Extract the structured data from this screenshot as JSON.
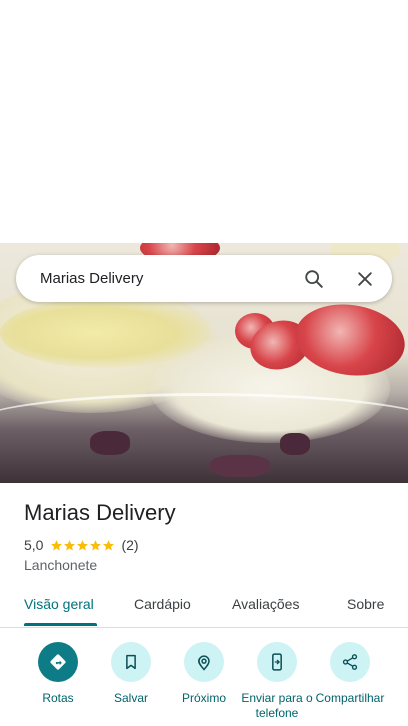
{
  "search": {
    "query": "Marias Delivery",
    "search_icon": "search-icon",
    "close_icon": "close-icon"
  },
  "place": {
    "name": "Marias Delivery",
    "rating_value": "5,0",
    "rating_stars": 5,
    "review_count": "(2)",
    "category": "Lanchonete"
  },
  "tabs": [
    {
      "label": "Visão geral",
      "active": true
    },
    {
      "label": "Cardápio",
      "active": false
    },
    {
      "label": "Avaliações",
      "active": false
    },
    {
      "label": "Sobre",
      "active": false
    }
  ],
  "actions": [
    {
      "label": "Rotas",
      "icon": "directions-icon"
    },
    {
      "label": "Salvar",
      "icon": "bookmark-icon"
    },
    {
      "label": "Próximo",
      "icon": "nearby-icon"
    },
    {
      "label": "Enviar para o telefone",
      "icon": "send-to-phone-icon"
    },
    {
      "label": "Compartilhar",
      "icon": "share-icon"
    }
  ],
  "colors": {
    "accent": "#00737a",
    "action_bg": "#cdf3f5",
    "primary_action_bg": "#0e7c86",
    "star": "#fbbc04"
  }
}
